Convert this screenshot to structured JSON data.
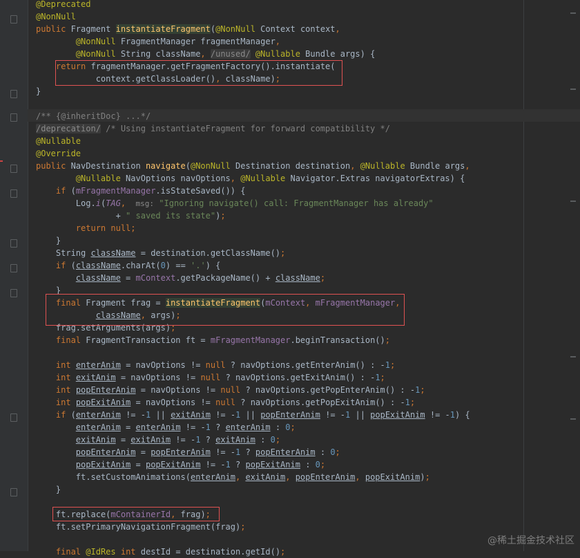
{
  "editor": {
    "lines": [
      [
        {
          "t": "@Deprecated",
          "c": "a"
        }
      ],
      [
        {
          "t": "@NonNull",
          "c": "a"
        }
      ],
      [
        {
          "t": "public ",
          "c": "k"
        },
        {
          "t": "Fragment "
        },
        {
          "t": "instantiateFragment",
          "c": "fh"
        },
        {
          "t": "("
        },
        {
          "t": "@NonNull ",
          "c": "a"
        },
        {
          "t": "Context context"
        },
        {
          "t": ",",
          "c": "k"
        }
      ],
      [
        {
          "t": "        "
        },
        {
          "t": "@NonNull ",
          "c": "a"
        },
        {
          "t": "FragmentManager fragmentManager"
        },
        {
          "t": ",",
          "c": "k"
        }
      ],
      [
        {
          "t": "        "
        },
        {
          "t": "@NonNull ",
          "c": "a"
        },
        {
          "t": "String className"
        },
        {
          "t": ", ",
          "c": "k"
        },
        {
          "t": "/unused/",
          "c": "inl"
        },
        {
          "t": " "
        },
        {
          "t": "@Nullable ",
          "c": "a"
        },
        {
          "t": "Bundle args) {"
        }
      ],
      [
        {
          "t": "    "
        },
        {
          "t": "return ",
          "c": "k"
        },
        {
          "t": "fragmentManager.getFragmentFactory().instantiate("
        }
      ],
      [
        {
          "t": "            "
        },
        {
          "t": "context.getClassLoader()"
        },
        {
          "t": ", ",
          "c": "k"
        },
        {
          "t": "className)"
        },
        {
          "t": ";",
          "c": "k"
        }
      ],
      [
        {
          "t": "}"
        }
      ],
      [],
      [
        {
          "t": "/** {@inheritDoc} ...*/",
          "c": "c"
        }
      ],
      [
        {
          "t": "/deprecation/",
          "c": "inl"
        },
        {
          "t": " /* Using instantiateFragment for forward compatibility */",
          "c": "c"
        }
      ],
      [
        {
          "t": "@Nullable",
          "c": "a"
        }
      ],
      [
        {
          "t": "@Override",
          "c": "a"
        }
      ],
      [
        {
          "t": "public ",
          "c": "k"
        },
        {
          "t": "NavDestination "
        },
        {
          "t": "navigate",
          "c": "f"
        },
        {
          "t": "("
        },
        {
          "t": "@NonNull ",
          "c": "a"
        },
        {
          "t": "Destination destination"
        },
        {
          "t": ", ",
          "c": "k"
        },
        {
          "t": "@Nullable ",
          "c": "a"
        },
        {
          "t": "Bundle args"
        },
        {
          "t": ",",
          "c": "k"
        }
      ],
      [
        {
          "t": "        "
        },
        {
          "t": "@Nullable ",
          "c": "a"
        },
        {
          "t": "NavOptions navOptions"
        },
        {
          "t": ", ",
          "c": "k"
        },
        {
          "t": "@Nullable ",
          "c": "a"
        },
        {
          "t": "Navigator.Extras navigatorExtras) {"
        }
      ],
      [
        {
          "t": "    "
        },
        {
          "t": "if ",
          "c": "k"
        },
        {
          "t": "("
        },
        {
          "t": "mFragmentManager",
          "c": "i"
        },
        {
          "t": ".isStateSaved()) {"
        }
      ],
      [
        {
          "t": "        "
        },
        {
          "t": "Log."
        },
        {
          "t": "i",
          "c": "ii"
        },
        {
          "t": "("
        },
        {
          "t": "TAG",
          "c": "ii"
        },
        {
          "t": ",  ",
          "c": "k"
        },
        {
          "t": "msg:",
          "c": "pl"
        },
        {
          "t": " "
        },
        {
          "t": "\"Ignoring navigate() call: FragmentManager has already\"",
          "c": "s"
        }
      ],
      [
        {
          "t": "                + "
        },
        {
          "t": "\" saved its state\"",
          "c": "s"
        },
        {
          "t": ")"
        },
        {
          "t": ";",
          "c": "k"
        }
      ],
      [
        {
          "t": "        "
        },
        {
          "t": "return null",
          "c": "k"
        },
        {
          "t": ";",
          "c": "k"
        }
      ],
      [
        {
          "t": "    }"
        }
      ],
      [
        {
          "t": "    "
        },
        {
          "t": "String "
        },
        {
          "t": "className",
          "c": "u"
        },
        {
          "t": " = destination.getClassName()"
        },
        {
          "t": ";",
          "c": "k"
        }
      ],
      [
        {
          "t": "    "
        },
        {
          "t": "if ",
          "c": "k"
        },
        {
          "t": "("
        },
        {
          "t": "className",
          "c": "u"
        },
        {
          "t": ".charAt("
        },
        {
          "t": "0",
          "c": "n"
        },
        {
          "t": ") == "
        },
        {
          "t": "'.'",
          "c": "s"
        },
        {
          "t": ") {"
        }
      ],
      [
        {
          "t": "        "
        },
        {
          "t": "className",
          "c": "u"
        },
        {
          "t": " = "
        },
        {
          "t": "mContext",
          "c": "i"
        },
        {
          "t": ".getPackageName() + "
        },
        {
          "t": "className",
          "c": "u"
        },
        {
          "t": ";",
          "c": "k"
        }
      ],
      [
        {
          "t": "    }"
        }
      ],
      [
        {
          "t": "    "
        },
        {
          "t": "final ",
          "c": "k"
        },
        {
          "t": "Fragment frag = "
        },
        {
          "t": "instantiateFragment",
          "c": "fh"
        },
        {
          "t": "("
        },
        {
          "t": "mContext",
          "c": "i"
        },
        {
          "t": ", ",
          "c": "k"
        },
        {
          "t": "mFragmentManager",
          "c": "i"
        },
        {
          "t": ",",
          "c": "k"
        }
      ],
      [
        {
          "t": "            "
        },
        {
          "t": "className",
          "c": "u"
        },
        {
          "t": ", ",
          "c": "k"
        },
        {
          "t": "args)"
        },
        {
          "t": ";",
          "c": "k"
        }
      ],
      [
        {
          "t": "    "
        },
        {
          "t": "frag.setArguments(args)"
        },
        {
          "t": ";",
          "c": "k"
        }
      ],
      [
        {
          "t": "    "
        },
        {
          "t": "final ",
          "c": "k"
        },
        {
          "t": "FragmentTransaction ft = "
        },
        {
          "t": "mFragmentManager",
          "c": "i"
        },
        {
          "t": ".beginTransaction()"
        },
        {
          "t": ";",
          "c": "k"
        }
      ],
      [],
      [
        {
          "t": "    "
        },
        {
          "t": "int ",
          "c": "k"
        },
        {
          "t": "enterAnim",
          "c": "u"
        },
        {
          "t": " = navOptions != "
        },
        {
          "t": "null ",
          "c": "k"
        },
        {
          "t": "? navOptions.getEnterAnim() : -"
        },
        {
          "t": "1",
          "c": "n"
        },
        {
          "t": ";",
          "c": "k"
        }
      ],
      [
        {
          "t": "    "
        },
        {
          "t": "int ",
          "c": "k"
        },
        {
          "t": "exitAnim",
          "c": "u"
        },
        {
          "t": " = navOptions != "
        },
        {
          "t": "null ",
          "c": "k"
        },
        {
          "t": "? navOptions.getExitAnim() : -"
        },
        {
          "t": "1",
          "c": "n"
        },
        {
          "t": ";",
          "c": "k"
        }
      ],
      [
        {
          "t": "    "
        },
        {
          "t": "int ",
          "c": "k"
        },
        {
          "t": "popEnterAnim",
          "c": "u"
        },
        {
          "t": " = navOptions != "
        },
        {
          "t": "null ",
          "c": "k"
        },
        {
          "t": "? navOptions.getPopEnterAnim() : -"
        },
        {
          "t": "1",
          "c": "n"
        },
        {
          "t": ";",
          "c": "k"
        }
      ],
      [
        {
          "t": "    "
        },
        {
          "t": "int ",
          "c": "k"
        },
        {
          "t": "popExitAnim",
          "c": "u"
        },
        {
          "t": " = navOptions != "
        },
        {
          "t": "null ",
          "c": "k"
        },
        {
          "t": "? navOptions.getPopExitAnim() : -"
        },
        {
          "t": "1",
          "c": "n"
        },
        {
          "t": ";",
          "c": "k"
        }
      ],
      [
        {
          "t": "    "
        },
        {
          "t": "if ",
          "c": "k"
        },
        {
          "t": "("
        },
        {
          "t": "enterAnim",
          "c": "u"
        },
        {
          "t": " != -"
        },
        {
          "t": "1 ",
          "c": "n"
        },
        {
          "t": "|| "
        },
        {
          "t": "exitAnim",
          "c": "u"
        },
        {
          "t": " != -"
        },
        {
          "t": "1 ",
          "c": "n"
        },
        {
          "t": "|| "
        },
        {
          "t": "popEnterAnim",
          "c": "u"
        },
        {
          "t": " != -"
        },
        {
          "t": "1 ",
          "c": "n"
        },
        {
          "t": "|| "
        },
        {
          "t": "popExitAnim",
          "c": "u"
        },
        {
          "t": " != -"
        },
        {
          "t": "1",
          "c": "n"
        },
        {
          "t": ") {"
        }
      ],
      [
        {
          "t": "        "
        },
        {
          "t": "enterAnim",
          "c": "u"
        },
        {
          "t": " = "
        },
        {
          "t": "enterAnim",
          "c": "u"
        },
        {
          "t": " != -"
        },
        {
          "t": "1 ",
          "c": "n"
        },
        {
          "t": "? "
        },
        {
          "t": "enterAnim",
          "c": "u"
        },
        {
          "t": " : "
        },
        {
          "t": "0",
          "c": "n"
        },
        {
          "t": ";",
          "c": "k"
        }
      ],
      [
        {
          "t": "        "
        },
        {
          "t": "exitAnim",
          "c": "u"
        },
        {
          "t": " = "
        },
        {
          "t": "exitAnim",
          "c": "u"
        },
        {
          "t": " != -"
        },
        {
          "t": "1 ",
          "c": "n"
        },
        {
          "t": "? "
        },
        {
          "t": "exitAnim",
          "c": "u"
        },
        {
          "t": " : "
        },
        {
          "t": "0",
          "c": "n"
        },
        {
          "t": ";",
          "c": "k"
        }
      ],
      [
        {
          "t": "        "
        },
        {
          "t": "popEnterAnim",
          "c": "u"
        },
        {
          "t": " = "
        },
        {
          "t": "popEnterAnim",
          "c": "u"
        },
        {
          "t": " != -"
        },
        {
          "t": "1 ",
          "c": "n"
        },
        {
          "t": "? "
        },
        {
          "t": "popEnterAnim",
          "c": "u"
        },
        {
          "t": " : "
        },
        {
          "t": "0",
          "c": "n"
        },
        {
          "t": ";",
          "c": "k"
        }
      ],
      [
        {
          "t": "        "
        },
        {
          "t": "popExitAnim",
          "c": "u"
        },
        {
          "t": " = "
        },
        {
          "t": "popExitAnim",
          "c": "u"
        },
        {
          "t": " != -"
        },
        {
          "t": "1 ",
          "c": "n"
        },
        {
          "t": "? "
        },
        {
          "t": "popExitAnim",
          "c": "u"
        },
        {
          "t": " : "
        },
        {
          "t": "0",
          "c": "n"
        },
        {
          "t": ";",
          "c": "k"
        }
      ],
      [
        {
          "t": "        "
        },
        {
          "t": "ft.setCustomAnimations("
        },
        {
          "t": "enterAnim",
          "c": "u"
        },
        {
          "t": ", ",
          "c": "k"
        },
        {
          "t": "exitAnim",
          "c": "u"
        },
        {
          "t": ", ",
          "c": "k"
        },
        {
          "t": "popEnterAnim",
          "c": "u"
        },
        {
          "t": ", ",
          "c": "k"
        },
        {
          "t": "popExitAnim",
          "c": "u"
        },
        {
          "t": ")"
        },
        {
          "t": ";",
          "c": "k"
        }
      ],
      [
        {
          "t": "    }"
        }
      ],
      [],
      [
        {
          "t": "    "
        },
        {
          "t": "ft.replace("
        },
        {
          "t": "mContainerId",
          "c": "i"
        },
        {
          "t": ", ",
          "c": "k"
        },
        {
          "t": "frag)"
        },
        {
          "t": ";",
          "c": "k"
        }
      ],
      [
        {
          "t": "    "
        },
        {
          "t": "ft.setPrimaryNavigationFragment(frag)"
        },
        {
          "t": ";",
          "c": "k"
        }
      ],
      [],
      [
        {
          "t": "    "
        },
        {
          "t": "final ",
          "c": "k"
        },
        {
          "t": "@IdRes ",
          "c": "a"
        },
        {
          "t": "int ",
          "c": "k"
        },
        {
          "t": "destId = destination.getId()"
        },
        {
          "t": ";",
          "c": "k"
        }
      ]
    ]
  },
  "watermark": "@稀土掘金技术社区"
}
